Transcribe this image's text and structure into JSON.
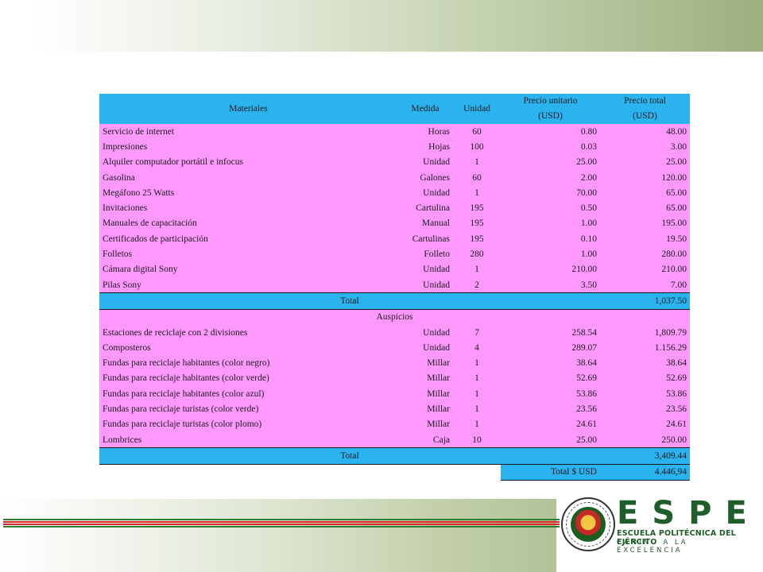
{
  "header": {
    "materiales": "Materiales",
    "medida": "Medida",
    "unidad": "Unidad",
    "precio_unitario_1": "Precio unitario",
    "precio_unitario_2": "(USD)",
    "precio_total_1": "Precio total",
    "precio_total_2": "(USD)"
  },
  "materiales": [
    {
      "name": "Servicio  de internet",
      "medida": "Horas",
      "unidad": "60",
      "pu": "0.80",
      "pt": "48.00"
    },
    {
      "name": "Impresiones",
      "medida": "Hojas",
      "unidad": "100",
      "pu": "0.03",
      "pt": "3.00"
    },
    {
      "name": "Alquiler  computador portátil e infocus",
      "medida": "Unidad",
      "unidad": "1",
      "pu": "25.00",
      "pt": "25.00"
    },
    {
      "name": "Gasolina",
      "medida": "Galones",
      "unidad": "60",
      "pu": "2.00",
      "pt": "120.00"
    },
    {
      "name": "Megáfono 25 Watts",
      "medida": "Unidad",
      "unidad": "1",
      "pu": "70.00",
      "pt": "65.00"
    },
    {
      "name": "Invitaciones",
      "medida": "Cartulina",
      "unidad": "195",
      "pu": "0.50",
      "pt": "65.00"
    },
    {
      "name": "Manuales de capacitación",
      "medida": "Manual",
      "unidad": "195",
      "pu": "1.00",
      "pt": "195.00"
    },
    {
      "name": "Certificados de participación",
      "medida": "Cartulinas",
      "unidad": "195",
      "pu": "0.10",
      "pt": "19.50"
    },
    {
      "name": "Folletos",
      "medida": "Folleto",
      "unidad": "280",
      "pu": "1.00",
      "pt": "280.00"
    },
    {
      "name": "Cámara digital Sony",
      "medida": "Unidad",
      "unidad": "1",
      "pu": "210.00",
      "pt": "210.00"
    },
    {
      "name": "Pilas Sony",
      "medida": "Unidad",
      "unidad": "2",
      "pu": "3.50",
      "pt": "7.00"
    }
  ],
  "total1": {
    "label": "Total",
    "value": "1,037.50"
  },
  "auspicios_label": "Auspicios",
  "auspicios": [
    {
      "name": "Estaciones de reciclaje con 2 divisiones",
      "medida": "Unidad",
      "unidad": "7",
      "pu": "258.54",
      "pt": "1,809.79"
    },
    {
      "name": "Composteros",
      "medida": "Unidad",
      "unidad": "4",
      "pu": "289.07",
      "pt": "1.156.29"
    },
    {
      "name": "Fundas para reciclaje habitantes (color negro)",
      "medida": "Millar",
      "unidad": "1",
      "pu": "38.64",
      "pt": "38.64"
    },
    {
      "name": "Fundas para reciclaje habitantes (color verde)",
      "medida": "Millar",
      "unidad": "1",
      "pu": "52.69",
      "pt": "52.69"
    },
    {
      "name": "Fundas para reciclaje habitantes (color azul)",
      "medida": "Millar",
      "unidad": "1",
      "pu": "53.86",
      "pt": "53.86"
    },
    {
      "name": "Fundas para reciclaje turistas (color verde)",
      "medida": "Millar",
      "unidad": "1",
      "pu": "23.56",
      "pt": "23.56"
    },
    {
      "name": "Fundas para reciclaje turistas (color plomo)",
      "medida": "Millar",
      "unidad": "1",
      "pu": "24.61",
      "pt": "24.61"
    },
    {
      "name": "Lombrices",
      "medida": "Caja",
      "unidad": "10",
      "pu": "25.00",
      "pt": "250.00"
    }
  ],
  "total2": {
    "label": "Total",
    "value": "3,409.44"
  },
  "grand_total": {
    "label": "Total $ USD",
    "value": "4.446,94"
  },
  "logo": {
    "word": "ESPE",
    "subtitle": "ESCUELA POLITÉCNICA DEL EJÉRCITO",
    "motto": "CAMINO A LA EXCELENCIA"
  },
  "colors": {
    "row_fill": "#ff99ff",
    "header_fill": "#2ab3ef",
    "brand_green": "#1f5d2a",
    "rule_red": "#d62828",
    "rule_green": "#2e7d32"
  }
}
